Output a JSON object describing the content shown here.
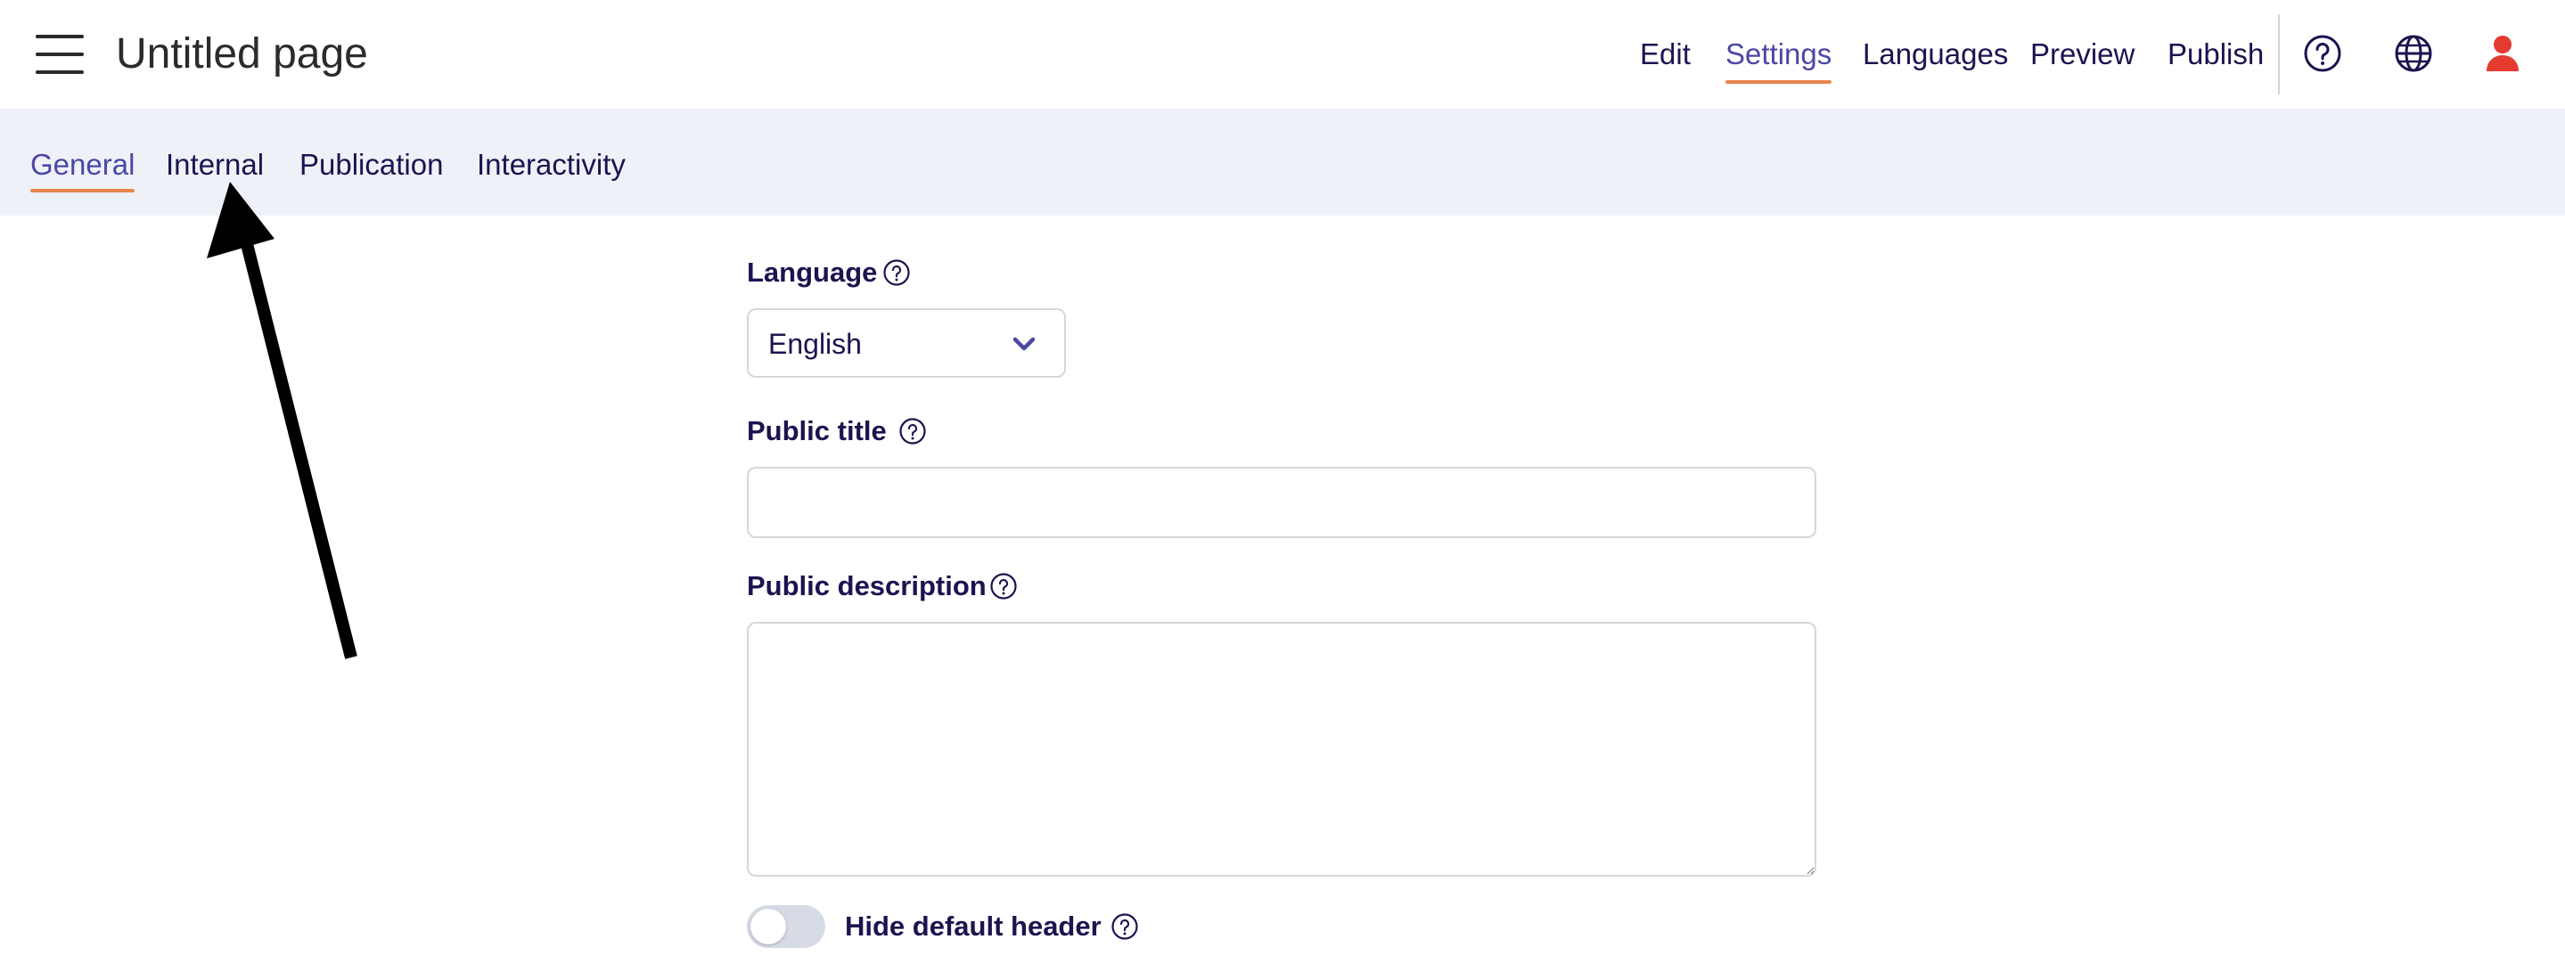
{
  "header": {
    "title": "Untitled page",
    "nav": [
      {
        "label": "Edit",
        "active": false
      },
      {
        "label": "Settings",
        "active": true
      },
      {
        "label": "Languages",
        "active": false
      },
      {
        "label": "Preview",
        "active": false
      },
      {
        "label": "Publish",
        "active": false
      }
    ],
    "icons": [
      "help-icon",
      "globe-icon",
      "user-icon"
    ]
  },
  "subtabs": [
    {
      "label": "General",
      "active": true
    },
    {
      "label": "Internal",
      "active": false
    },
    {
      "label": "Publication",
      "active": false
    },
    {
      "label": "Interactivity",
      "active": false
    }
  ],
  "form": {
    "language": {
      "label": "Language",
      "value": "English"
    },
    "public_title": {
      "label": "Public title",
      "value": ""
    },
    "public_description": {
      "label": "Public description",
      "value": ""
    },
    "hide_header": {
      "label": "Hide default header",
      "on": false
    }
  },
  "colors": {
    "accent": "#4b47a6",
    "underline": "#e9854c",
    "text": "#1b1450",
    "subbar_bg": "#eef2f8",
    "user_icon": "#e53a2f"
  }
}
